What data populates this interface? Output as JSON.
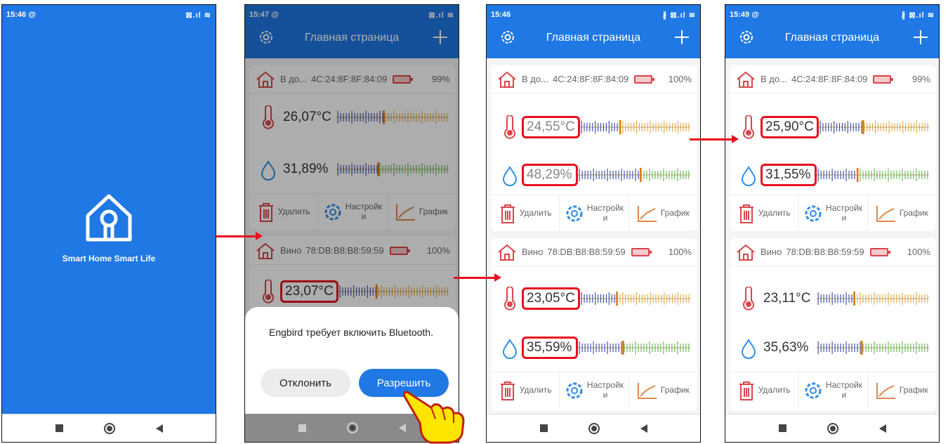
{
  "colors": {
    "brand": "#1f78e4",
    "highlight": "#e8101e",
    "battery": "#d9464b"
  },
  "screen1": {
    "status_time": "15:46 @",
    "status_icons": "⊠.ıl ≋",
    "slogan": "Smart Home Smart Life"
  },
  "screen2": {
    "status_time": "15:47 @",
    "status_icons": "⊠.ıl ≋",
    "title": "Главная страница",
    "device1": {
      "name": "В до...",
      "mac": "4C:24:8F:8F:84:09",
      "battery": "99%",
      "temp": "26,07°C",
      "hum": "31,89%"
    },
    "device2": {
      "name": "Вино",
      "mac": "78:DB:B8:B8:59:59",
      "battery": "100%",
      "temp": "23,07°C"
    },
    "actions": {
      "delete": "Удалить",
      "settings": "Настройк\nи",
      "chart": "График"
    },
    "dialog": {
      "message": "Engbird требует включить Bluetooth.",
      "deny": "Отклонить",
      "allow": "Разрешить"
    }
  },
  "screen3": {
    "status_time": "15:46",
    "status_icons": "∦ ⊠.ıl ≋",
    "title": "Главная страница",
    "device1": {
      "name": "В до...",
      "mac": "4C:24:8F:8F:84:09",
      "battery": "100%",
      "temp": "24,55°C",
      "hum": "48,29%"
    },
    "device2": {
      "name": "Вино",
      "mac": "78:DB:B8:B8:59:59",
      "battery": "100%",
      "temp": "23,05°C",
      "hum": "35,59%"
    },
    "actions": {
      "delete": "Удалить",
      "settings": "Настройк\nи",
      "chart": "График"
    }
  },
  "screen4": {
    "status_time": "15:49 @",
    "status_icons": "∦ ⊠.ıl ≋",
    "title": "Главная страница",
    "device1": {
      "name": "В до...",
      "mac": "4C:24:8F:8F:84:09",
      "battery": "99%",
      "temp": "25,90°C",
      "hum": "31,55%"
    },
    "device2": {
      "name": "Вино",
      "mac": "78:DB:B8:B8:59:59",
      "battery": "100%",
      "temp": "23,11°C",
      "hum": "35,63%"
    },
    "actions": {
      "delete": "Удалить",
      "settings": "Настройк\nи",
      "chart": "График"
    }
  }
}
